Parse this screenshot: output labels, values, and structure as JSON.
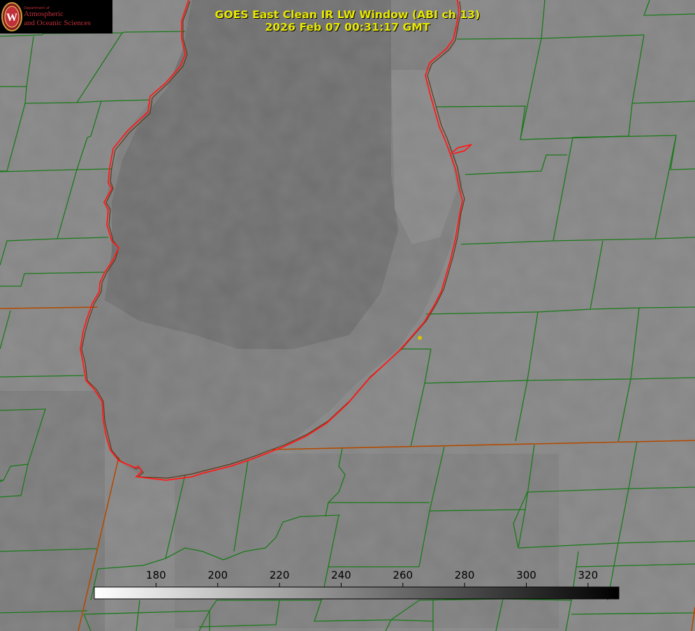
{
  "logo": {
    "department": "Department of",
    "line1": "Atmospheric",
    "line2": "and Oceanic Sciences",
    "crest_letter": "W"
  },
  "title": {
    "line1": "GOES East Clean IR LW Window (ABI ch 13)",
    "line2": "2026 Feb 07 00:31:17 GMT"
  },
  "colorbar": {
    "min": 160,
    "max": 330,
    "ticks": [
      "180",
      "200",
      "220",
      "240",
      "260",
      "280",
      "300",
      "320"
    ],
    "color_low": "#ffffff",
    "color_high": "#000000"
  },
  "colors": {
    "title": "#e8e800",
    "county_lines": "#1a7a1a",
    "state_lines": "#b34a00",
    "lake_outline": "#ff2020",
    "marker": "#d4c400",
    "logo_red": "#c0303a"
  },
  "marker": {
    "label": "location-dot"
  }
}
